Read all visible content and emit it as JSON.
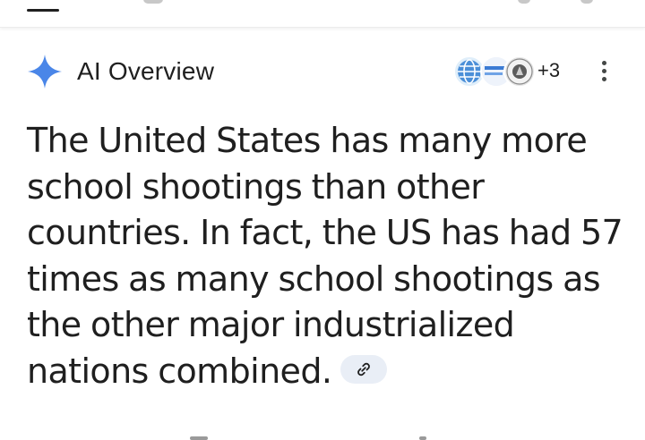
{
  "header": {
    "title": "AI Overview",
    "more_sources": "+3"
  },
  "overview": {
    "text": "The United States has many more school shootings than other countries. In fact, the US has had 57 times as many school shootings as the other major industrialized nations combined."
  },
  "icons": {
    "sparkle": "gemini-sparkle-icon",
    "link": "link-icon",
    "menu": "more-vert-icon"
  },
  "colors": {
    "sparkle": "#4a86e8",
    "chip_bg": "#e9eef6",
    "text": "#1f1f1f"
  }
}
